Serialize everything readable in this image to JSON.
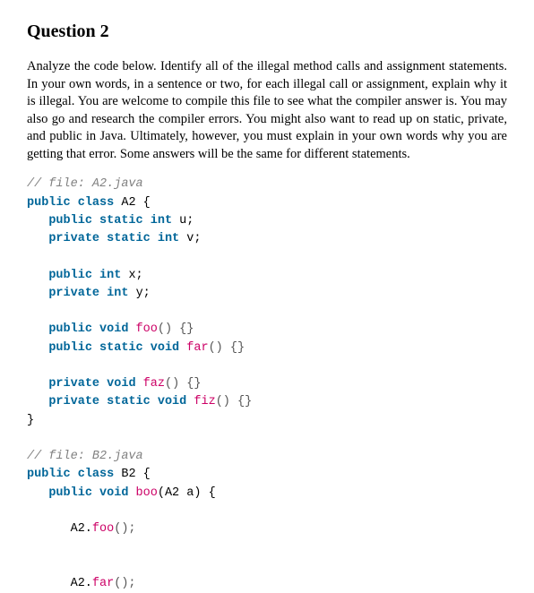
{
  "heading": "Question 2",
  "paragraph": "Analyze the code below. Identify all of the illegal method calls and assignment statements. In your own words, in a sentence or two, for each illegal call or assignment, explain why it is illegal. You are welcome to compile this file to see what the compiler answer is. You may also go and research the compiler errors. You might also want to read up on static, private, and public in Java. Ultimately, however, you must explain in your own words why you are getting that error. Some answers will be the same for different statements.",
  "code": {
    "c00": "// file: A2.java",
    "c01a": "public",
    "c01b": "class",
    "c01c": "A2 {",
    "c02a": "public",
    "c02b": "static",
    "c02c": "int",
    "c02d": "u;",
    "c03a": "private",
    "c03b": "static",
    "c03c": "int",
    "c03d": "v;",
    "c04a": "public",
    "c04b": "int",
    "c04c": "x;",
    "c05a": "private",
    "c05b": "int",
    "c05c": "y;",
    "c06a": "public",
    "c06b": "void",
    "c06c": "foo",
    "c06d": "() {}",
    "c07a": "public",
    "c07b": "static",
    "c07c": "void",
    "c07d": "far",
    "c07e": "() {}",
    "c08a": "private",
    "c08b": "void",
    "c08c": "faz",
    "c08d": "() {}",
    "c09a": "private",
    "c09b": "static",
    "c09c": "void",
    "c09d": "fiz",
    "c09e": "() {}",
    "c10": "}",
    "c11": "// file: B2.java",
    "c12a": "public",
    "c12b": "class",
    "c12c": "B2 {",
    "c13a": "public",
    "c13b": "void",
    "c13c": "boo",
    "c13d": "(A2 a) {",
    "c14a": "A2.",
    "c14b": "foo",
    "c14c": "();",
    "c15a": "A2.",
    "c15b": "far",
    "c15c": "();"
  }
}
